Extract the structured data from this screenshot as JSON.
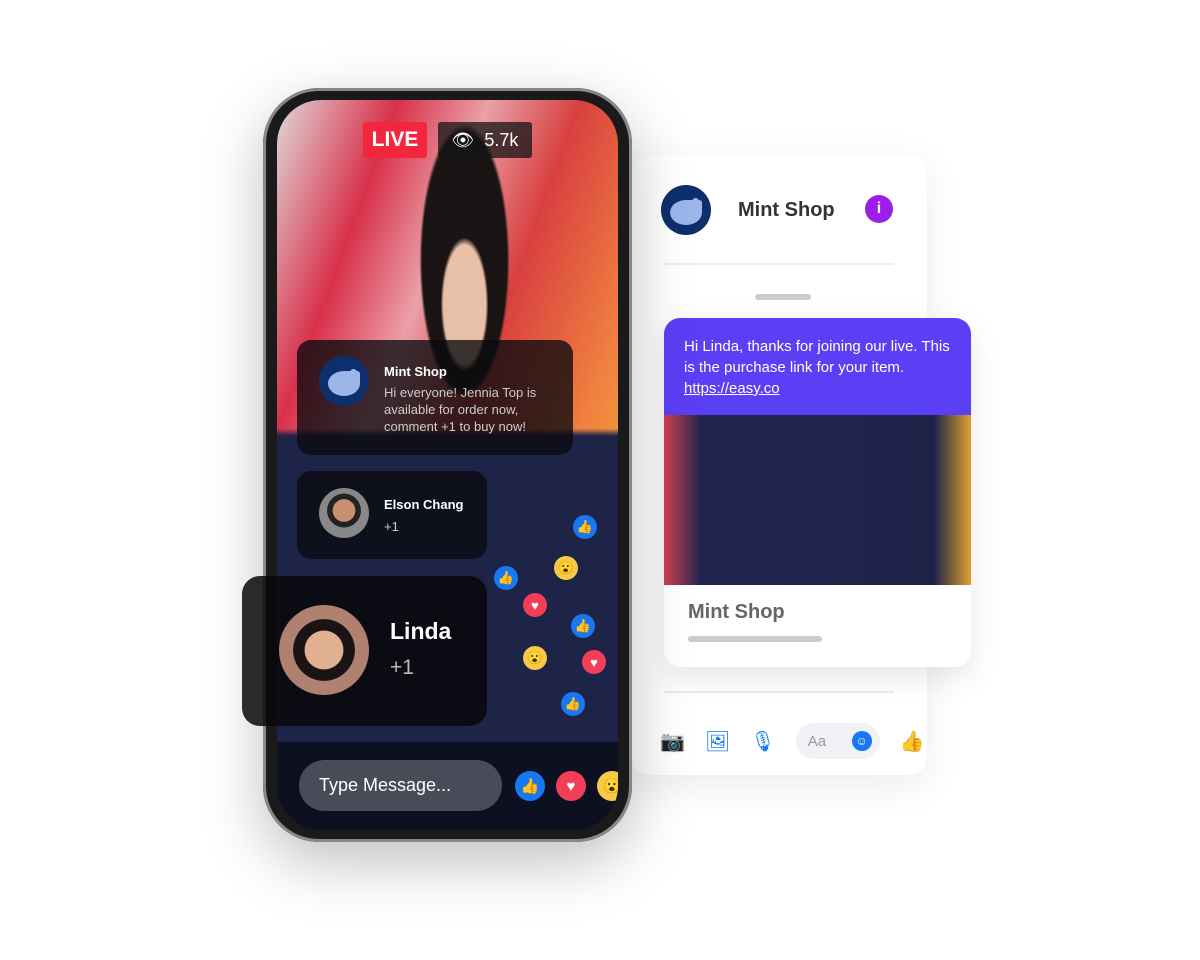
{
  "live": {
    "badge": "LIVE",
    "viewers": "5.7k"
  },
  "comments": [
    {
      "name": "Mint Shop",
      "text": "Hi everyone! Jennia Top is available for order now, comment +1 to buy now!"
    },
    {
      "name": "Elson Chang",
      "text": "+1"
    },
    {
      "name": "Linda",
      "text": "+1"
    }
  ],
  "composer": {
    "placeholder": "Type Message..."
  },
  "chat": {
    "title": "Mint Shop",
    "message": "Hi Linda, thanks for joining our live. This is the purchase link for your item.",
    "link": "https://easy.co",
    "card_title": "Mint Shop",
    "input_placeholder": "Aa"
  },
  "colors": {
    "live": "#f4263e",
    "accent": "#5b3ff5",
    "info": "#9b1fe8",
    "messenger": "#1877f2"
  }
}
